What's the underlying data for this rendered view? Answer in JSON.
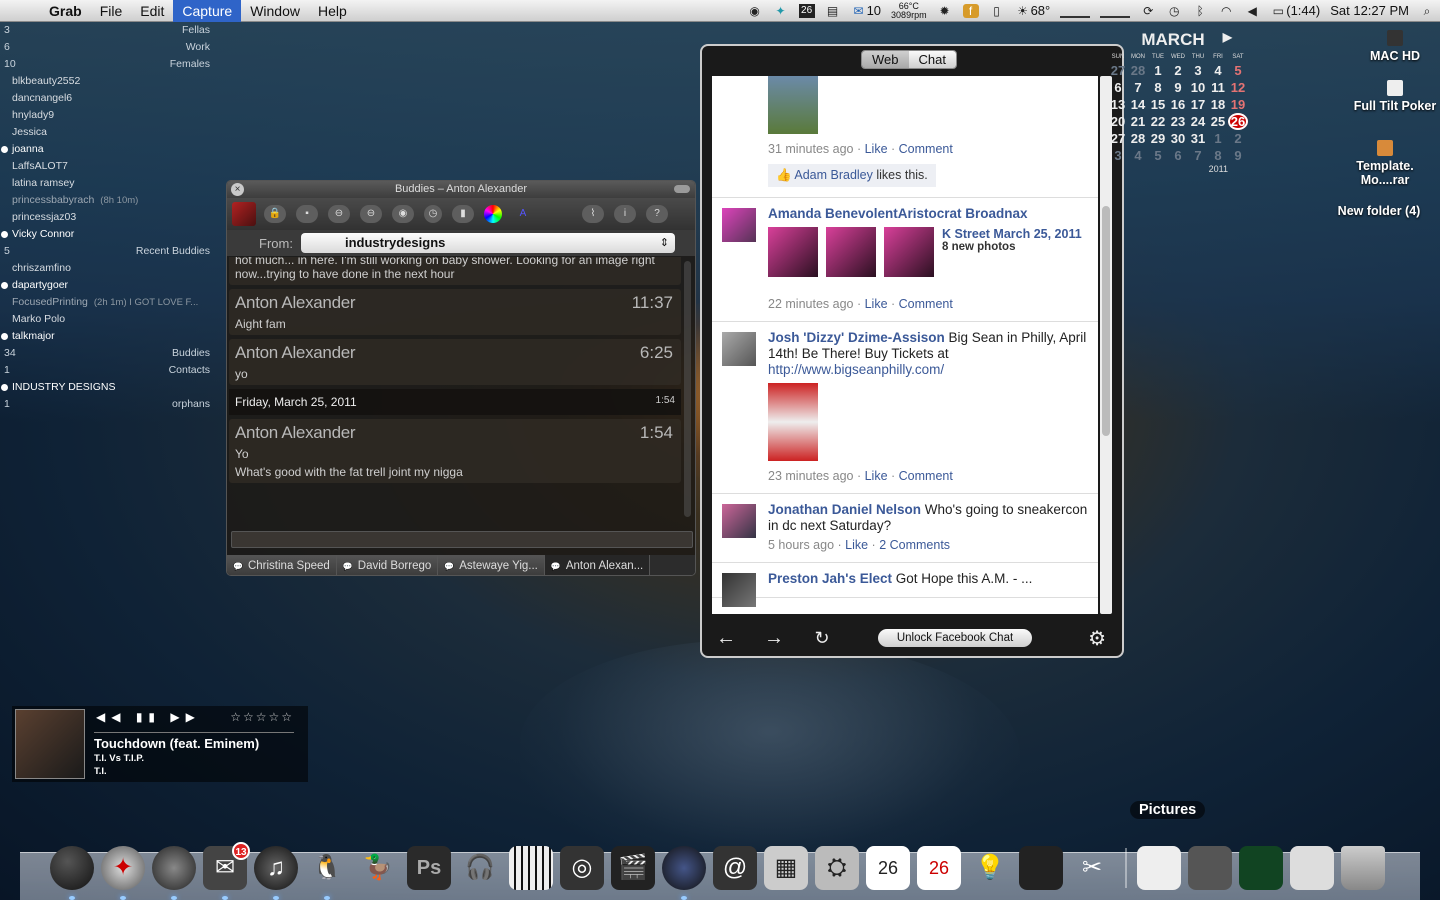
{
  "menubar": {
    "app": "Grab",
    "menus": [
      "File",
      "Edit",
      "Capture",
      "Window",
      "Help"
    ],
    "active_menu": "Capture",
    "calendar_day": "26",
    "mail_count": "10",
    "cpu_temp": "66°C",
    "fan_rpm": "3089rpm",
    "weather_temp": "68°",
    "battery": "(1:44)",
    "clock": "Sat 12:27 PM"
  },
  "buddylist": {
    "rows": [
      {
        "kind": "group",
        "count": "3",
        "name": "Fellas"
      },
      {
        "kind": "group",
        "count": "6",
        "name": "Work"
      },
      {
        "kind": "group",
        "count": "10",
        "name": "Females"
      },
      {
        "kind": "buddy",
        "name": "blkbeauty2552"
      },
      {
        "kind": "buddy",
        "name": "dancnangel6"
      },
      {
        "kind": "buddy",
        "name": "hnylady9"
      },
      {
        "kind": "buddy",
        "name": "Jessica"
      },
      {
        "kind": "buddy",
        "name": "joanna",
        "state": "online"
      },
      {
        "kind": "buddy",
        "name": "LaffsALOT7"
      },
      {
        "kind": "buddy",
        "name": "latina ramsey"
      },
      {
        "kind": "buddy",
        "name": "princessbabyrach",
        "status": "(8h 10m)",
        "state": "away"
      },
      {
        "kind": "buddy",
        "name": "princessjaz03"
      },
      {
        "kind": "buddy",
        "name": "Vicky Connor",
        "state": "online"
      },
      {
        "kind": "group",
        "count": "5",
        "name": "Recent Buddies"
      },
      {
        "kind": "buddy",
        "name": "chriszamfino"
      },
      {
        "kind": "buddy",
        "name": "dapartygoer",
        "state": "online"
      },
      {
        "kind": "buddy",
        "name": "FocusedPrinting",
        "status": "(2h 1m)  I GOT LOVE F...",
        "state": "away"
      },
      {
        "kind": "buddy",
        "name": "Marko Polo"
      },
      {
        "kind": "buddy",
        "name": "talkmajor",
        "state": "online"
      },
      {
        "kind": "group",
        "count": "34",
        "name": "Buddies"
      },
      {
        "kind": "group",
        "count": "1",
        "name": "Contacts"
      },
      {
        "kind": "buddy",
        "name": "INDUSTRY DESIGNS",
        "state": "online"
      },
      {
        "kind": "group",
        "count": "1",
        "name": "orphans"
      }
    ]
  },
  "chat": {
    "title": "Buddies – Anton Alexander",
    "from_label": "From:",
    "from_value": "industrydesigns",
    "partial_text": "hot much... in here.  I'm still working on baby shower.  Looking for an image right now...trying to have done in the next hour",
    "messages": [
      {
        "who": "Anton Alexander",
        "time": "11:37",
        "text": "Aight fam"
      },
      {
        "who": "Anton Alexander",
        "time": "6:25",
        "text": "yo"
      }
    ],
    "date_label": "Friday, March 25, 2011",
    "date_time": "1:54",
    "last": {
      "who": "Anton Alexander",
      "time": "1:54",
      "text1": "Yo",
      "text2": "What's good with the fat trell joint my nigga"
    },
    "tabs": [
      "Christina Speed",
      "David Borrego",
      "Astewaye Yig...",
      "Anton Alexan..."
    ]
  },
  "facebook": {
    "seg_web": "Web",
    "seg_chat": "Chat",
    "post0": {
      "meta_time": "31 minutes ago",
      "like": "Like",
      "comment": "Comment",
      "liker": "Adam Bradley",
      "likes_suffix": " likes this."
    },
    "post1": {
      "name": "Amanda BenevolentAristocrat Broadnax",
      "album": "K Street March 25, 2011",
      "album_sub": "8 new photos",
      "meta_time": "22 minutes ago",
      "like": "Like",
      "comment": "Comment"
    },
    "post2": {
      "name": "Josh 'Dizzy' Dzime-Assison",
      "text": " Big Sean in Philly, April 14th! Be There! Buy Tickets at",
      "link": "http://www.bigseanphilly.com/",
      "meta_time": "23 minutes ago",
      "like": "Like",
      "comment": "Comment"
    },
    "post3": {
      "name": "Jonathan Daniel Nelson",
      "text": " Who's going to sneakercon in dc next Saturday?",
      "meta_time": "5 hours ago",
      "like": "Like",
      "comment": "2 Comments"
    },
    "post4": {
      "name": "Preston Jah's Elect",
      "text": " Got Hope this A.M. - ..."
    },
    "unlock_label": "Unlock Facebook Chat"
  },
  "calendar": {
    "month": "MARCH",
    "dow": [
      "SUN",
      "MON",
      "TUE",
      "WED",
      "THU",
      "FRI",
      "SAT"
    ],
    "weeks": [
      [
        "27",
        "28",
        "1",
        "2",
        "3",
        "4",
        "5"
      ],
      [
        "6",
        "7",
        "8",
        "9",
        "10",
        "11",
        "12"
      ],
      [
        "13",
        "14",
        "15",
        "16",
        "17",
        "18",
        "19"
      ],
      [
        "20",
        "21",
        "22",
        "23",
        "24",
        "25",
        "26"
      ],
      [
        "27",
        "28",
        "29",
        "30",
        "31",
        "1",
        "2"
      ],
      [
        "3",
        "4",
        "5",
        "6",
        "7",
        "8",
        "9"
      ]
    ],
    "today": "26",
    "year": "2011"
  },
  "desktop_icons": [
    "MAC HD",
    "Full Tilt Poker",
    "Template. Mo....rar",
    "New folder (4)"
  ],
  "music": {
    "song": "Touchdown (feat. Eminem)",
    "album": "T.I. Vs T.I.P.",
    "artist": "T.I.",
    "stars": "☆☆☆☆☆"
  },
  "dock": {
    "hover_label": "Pictures",
    "mail_badge": "13",
    "items": [
      "bomb",
      "safari",
      "globe",
      "mail",
      "itunes",
      "adium",
      "cyberduck",
      "photoshop",
      "headphones",
      "garageband",
      "dvd",
      "final-cut",
      "camera",
      "address-book",
      "picture-viewer",
      "gasmask",
      "calendar",
      "ical",
      "bulb",
      "apple-tv",
      "tools"
    ],
    "stack_items": [
      "pictures",
      "folder",
      "image",
      "downloads",
      "trash"
    ]
  }
}
